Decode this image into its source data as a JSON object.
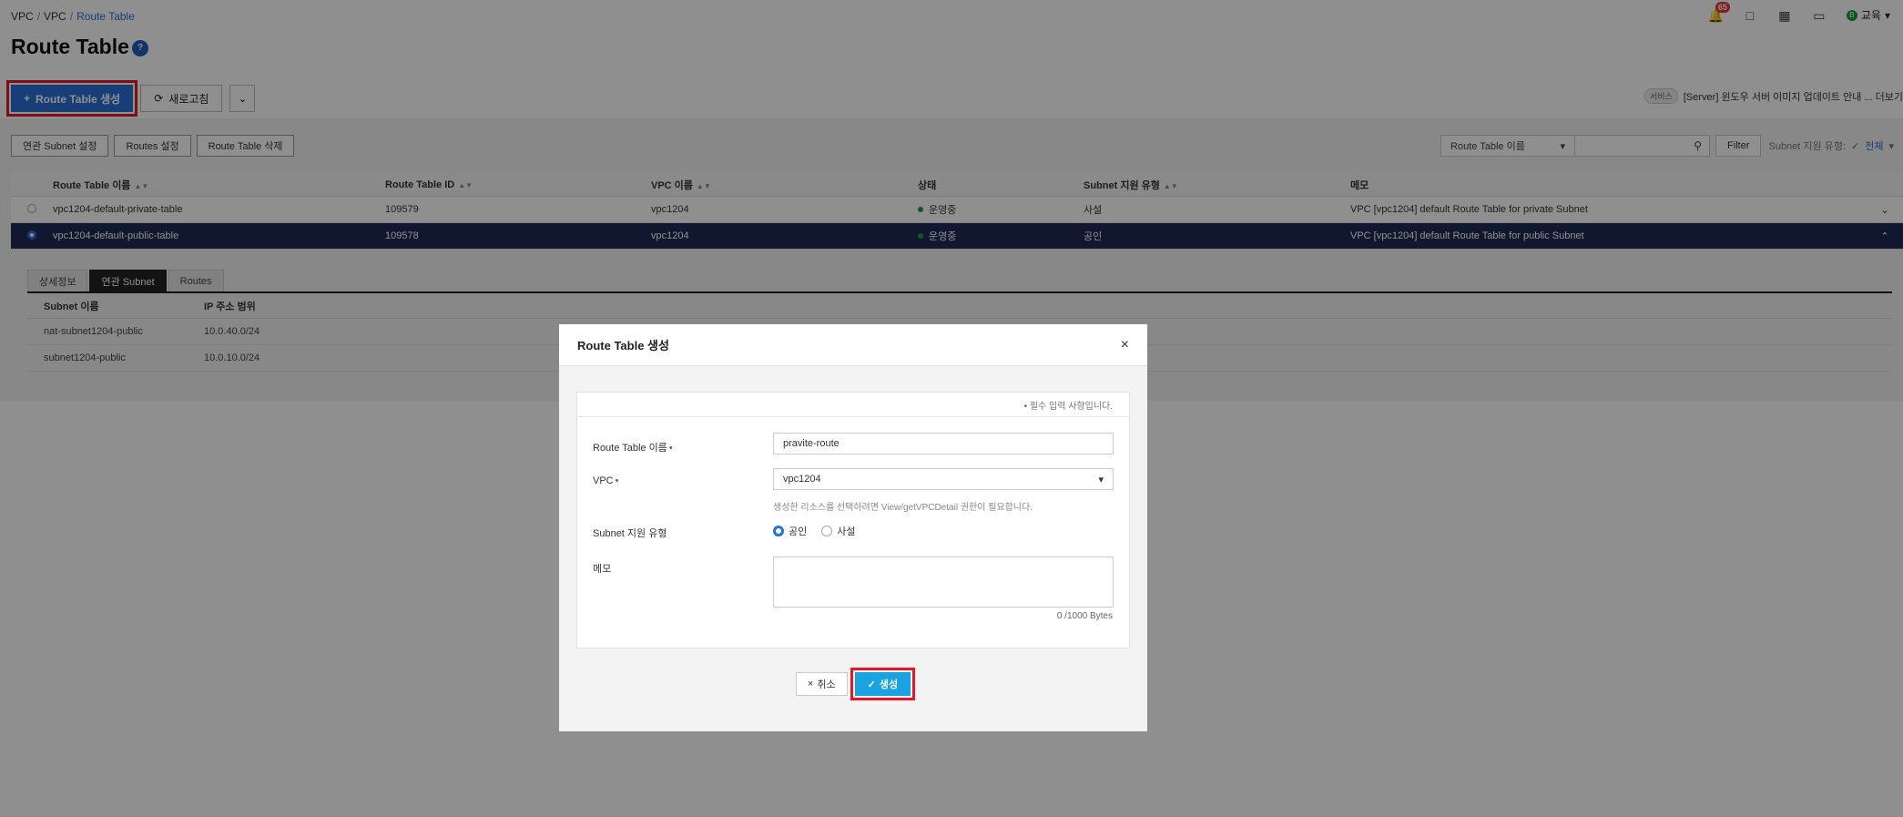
{
  "breadcrumb": {
    "items": [
      "VPC",
      "VPC",
      "Route Table"
    ],
    "sep": "/"
  },
  "topbar": {
    "notification_count": "65",
    "user_label": "교육",
    "user_initial": "B"
  },
  "page": {
    "title": "Route Table",
    "help": "?"
  },
  "toolbar": {
    "create_label": "Route Table 생성",
    "refresh_label": "새로고침"
  },
  "notice": {
    "tag": "서비스",
    "text": "[Server] 윈도우 서버 이미지 업데이트 안내 ... 더보기"
  },
  "actions": {
    "subnet_settings": "연관 Subnet 설정",
    "routes_settings": "Routes 설정",
    "delete": "Route Table 삭제"
  },
  "filter": {
    "select_label": "Route Table 이름",
    "button": "Filter",
    "subnet_label": "Subnet 지원 유형:",
    "subnet_value": "전체"
  },
  "table": {
    "headers": [
      "Route Table 이름",
      "Route Table ID",
      "VPC 이름",
      "상태",
      "Subnet 지원 유형",
      "메모"
    ],
    "rows": [
      {
        "name": "vpc1204-default-private-table",
        "id": "109579",
        "vpc": "vpc1204",
        "state": "운영중",
        "type": "사설",
        "memo": "VPC [vpc1204] default Route Table for private Subnet",
        "selected": false
      },
      {
        "name": "vpc1204-default-public-table",
        "id": "109578",
        "vpc": "vpc1204",
        "state": "운영중",
        "type": "공인",
        "memo": "VPC [vpc1204] default Route Table for public Subnet",
        "selected": true
      }
    ]
  },
  "detail": {
    "tabs": [
      "상세정보",
      "연관 Subnet",
      "Routes"
    ],
    "active_tab": 1,
    "headers": [
      "Subnet 이름",
      "IP 주소 범위"
    ],
    "rows": [
      {
        "name": "nat-subnet1204-public",
        "range": "10.0.40.0/24"
      },
      {
        "name": "subnet1204-public",
        "range": "10.0.10.0/24"
      }
    ]
  },
  "modal": {
    "title": "Route Table 생성",
    "required_note": "필수 입력 사항입니다.",
    "name_label": "Route Table 이름",
    "name_value": "pravite-route",
    "vpc_label": "VPC",
    "vpc_value": "vpc1204",
    "vpc_hint": "생성한 리소스를 선택하려면 View/getVPCDetail 권한이 필요합니다.",
    "type_label": "Subnet 지원 유형",
    "type_options": [
      "공인",
      "사설"
    ],
    "type_selected": "공인",
    "memo_label": "메모",
    "bytes": "0 /1000 Bytes",
    "cancel_label": "취소",
    "create_label": "생성"
  },
  "colors": {
    "accent": "#2a6fd6",
    "highlight": "#e3192a",
    "selected_row": "#1e2a52",
    "ok_button": "#1aa3e0"
  }
}
